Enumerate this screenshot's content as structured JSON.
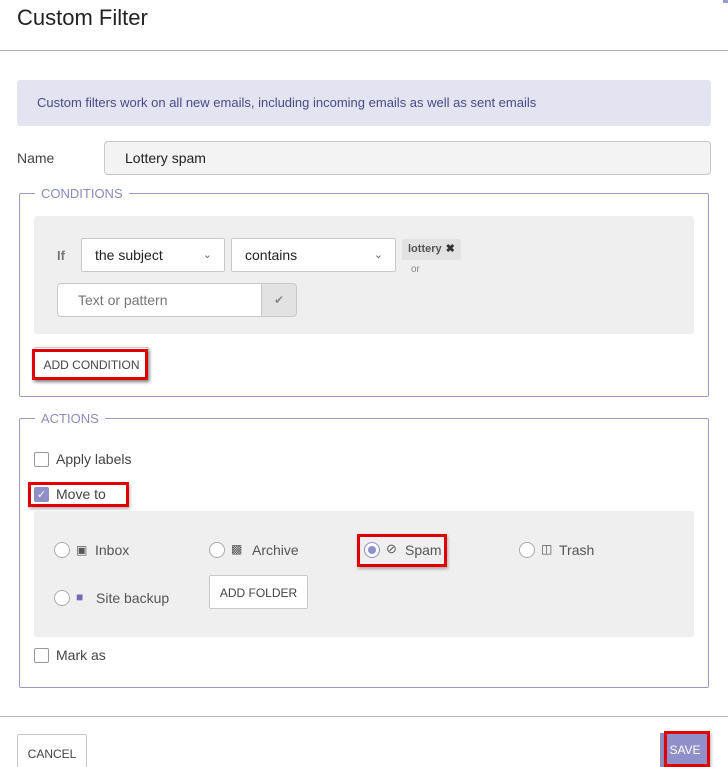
{
  "dialog": {
    "title": "Custom Filter",
    "info_message": "Custom filters work on all new emails, including incoming emails as well as sent emails"
  },
  "name_field": {
    "label": "Name",
    "value": "Lottery spam"
  },
  "conditions": {
    "legend": "CONDITIONS",
    "if_label": "If",
    "field_select": "the subject",
    "operator_select": "contains",
    "tags": [
      {
        "label": "lottery",
        "remove_icon": "close-icon"
      }
    ],
    "or_label": "or",
    "pattern_placeholder": "Text or pattern",
    "confirm_icon": "check-icon",
    "add_button": "ADD CONDITION"
  },
  "actions": {
    "legend": "ACTIONS",
    "apply_labels": {
      "label": "Apply labels",
      "checked": false
    },
    "move_to": {
      "label": "Move to",
      "checked": true
    },
    "folders": [
      {
        "label": "Inbox",
        "icon": "inbox-icon",
        "selected": false
      },
      {
        "label": "Archive",
        "icon": "archive-icon",
        "selected": false
      },
      {
        "label": "Spam",
        "icon": "ban-icon",
        "selected": true
      },
      {
        "label": "Trash",
        "icon": "trash-icon",
        "selected": false
      },
      {
        "label": "Site backup",
        "icon": "folder-icon",
        "selected": false
      }
    ],
    "add_folder_button": "ADD FOLDER",
    "mark_as": {
      "label": "Mark as",
      "checked": false
    }
  },
  "footer": {
    "cancel": "CANCEL",
    "save": "SAVE"
  },
  "colors": {
    "accent": "#8f8fc9",
    "highlight": "#e00000",
    "info_bg": "#e3e3f1"
  }
}
